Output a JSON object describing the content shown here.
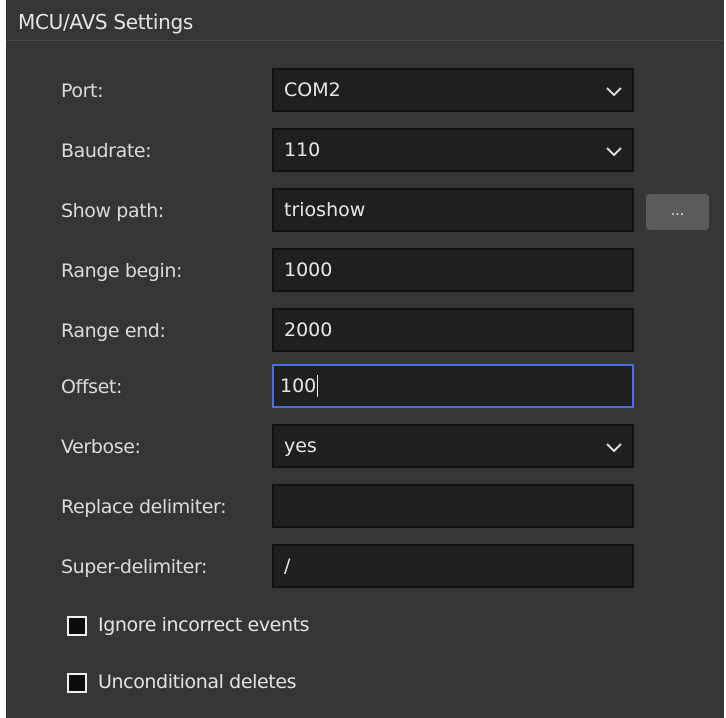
{
  "panel": {
    "title": "MCU/AVS Settings"
  },
  "fields": {
    "port": {
      "label": "Port:",
      "value": "COM2"
    },
    "baudrate": {
      "label": "Baudrate:",
      "value": "110"
    },
    "show_path": {
      "label": "Show path:",
      "value": "trioshow",
      "browse_label": "..."
    },
    "range_begin": {
      "label": "Range begin:",
      "value": "1000"
    },
    "range_end": {
      "label": "Range end:",
      "value": "2000"
    },
    "offset": {
      "label": "Offset:",
      "value": "100"
    },
    "verbose": {
      "label": "Verbose:",
      "value": "yes"
    },
    "replace_delimiter": {
      "label": "Replace delimiter:",
      "value": ""
    },
    "super_delimiter": {
      "label": "Super-delimiter:",
      "value": "/"
    }
  },
  "checkboxes": {
    "ignore_incorrect_events": {
      "label": "Ignore incorrect events",
      "checked": false
    },
    "unconditional_deletes": {
      "label": "Unconditional deletes",
      "checked": false
    }
  },
  "icons": {
    "dropdown": "chevron-down-icon",
    "browse": "ellipsis"
  },
  "colors": {
    "panel_bg": "#353535",
    "field_bg": "#1f1f1f",
    "focus_border": "#4a6ee0",
    "browse_button": "#5b5b5b"
  }
}
